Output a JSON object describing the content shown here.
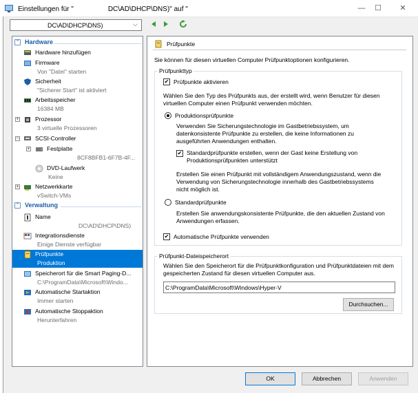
{
  "window": {
    "title_prefix": "Einstellungen für \"",
    "title_mid": "DC\\AD\\DHCP\\DNS)\" auf \"",
    "title_suffix": "",
    "minimize": "—",
    "maximize": "☐",
    "close": "✕"
  },
  "toolbar": {
    "vm_select": "DC\\AD\\DHCP\\DNS)"
  },
  "tree": {
    "hardware_header": "Hardware",
    "management_header": "Verwaltung",
    "items": [
      {
        "label": "Hardware hinzufügen",
        "sub": ""
      },
      {
        "label": "Firmware",
        "sub": "Von \"Datei\" starten"
      },
      {
        "label": "Sicherheit",
        "sub": "\"Sicherer Start\" ist aktiviert"
      },
      {
        "label": "Arbeitsspeicher",
        "sub": "16384 MB"
      },
      {
        "label": "Prozessor",
        "sub": "3 virtuelle Prozessoren"
      },
      {
        "label": "SCSI-Controller",
        "sub": ""
      },
      {
        "label": "Festplatte",
        "sub": "8CF8BFB1-6F7B-4F..."
      },
      {
        "label": "DVD-Laufwerk",
        "sub": "Keine"
      },
      {
        "label": "Netzwerkkarte",
        "sub": "vSwitch-VMs"
      },
      {
        "label": "Name",
        "sub": "DC\\AD\\DHCP\\DNS)"
      },
      {
        "label": "Integrationsdienste",
        "sub": "Einige Dienste verfügbar"
      },
      {
        "label": "Prüfpunkte",
        "sub": "Produktion"
      },
      {
        "label": "Speicherort für die Smart Paging-D...",
        "sub": "C:\\ProgramData\\Microsoft\\Windo..."
      },
      {
        "label": "Automatische Startaktion",
        "sub": "Immer starten"
      },
      {
        "label": "Automatische Stoppaktion",
        "sub": "Herunterfahren"
      }
    ]
  },
  "panel": {
    "title": "Prüfpunkte",
    "intro": "Sie können für diesen virtuellen Computer Prüfpunktoptionen konfigurieren.",
    "type_group": "Prüfpunkttyp",
    "enable_label": "Prüfpunkte aktivieren",
    "choose_text": "Wählen Sie den Typ des Prüfpunkts aus, der erstellt wird, wenn Benutzer für diesen virtuellen Computer einen Prüfpunkt verwenden möchten.",
    "production_label": "Produktionsprüfpunkte",
    "production_desc": "Verwenden Sie Sicherungstechnologie im Gastbetriebssystem, um datenkonsistente Prüfpunkte zu erstellen, die keine Informationen zu ausgeführten Anwendungen enthalten.",
    "fallback_label": "Standardprüfpunkte erstellen, wenn der Gast keine Erstellung von Produktionsprüfpunkten unterstützt",
    "fullstate_desc": "Erstellen Sie einen Prüfpunkt mit vollständigem Anwendungszustand, wenn die Verwendung von Sicherungstechnologie innerhalb des Gastbetriebssystems nicht möglich ist.",
    "standard_label": "Standardprüfpunkte",
    "standard_desc": "Erstellen Sie anwendungskonsistente Prüfpunkte, die den aktuellen Zustand von Anwendungen erfassen.",
    "auto_label": "Automatische Prüfpunkte verwenden",
    "location_group": "Prüfpunkt-Dateispeicherort",
    "location_desc": "Wählen Sie den Speicherort für die Prüfpunktkonfiguration und Prüfpunktdateien mit dem gespeicherten Zustand für diesen virtuellen Computer aus.",
    "location_value": "C:\\ProgramData\\Microsoft\\Windows\\Hyper-V",
    "browse": "Durchsuchen...",
    "checkmark": "✔"
  },
  "buttons": {
    "ok": "OK",
    "cancel": "Abbrechen",
    "apply": "Anwenden"
  },
  "colors": {
    "accent": "#0078d7",
    "section": "#1f5ea8",
    "nav_green": "#3c9a3c"
  }
}
